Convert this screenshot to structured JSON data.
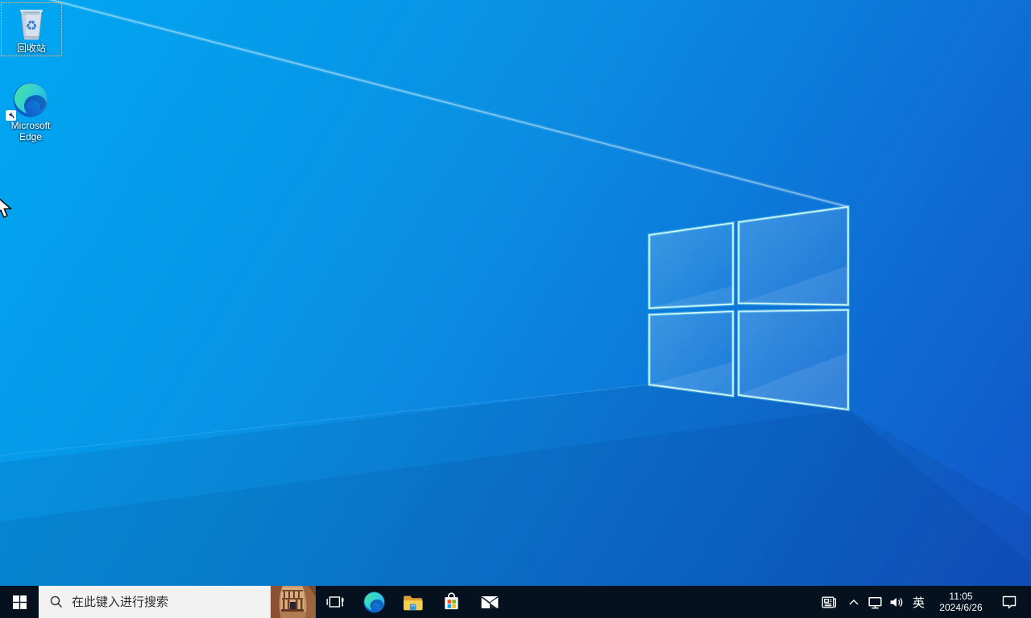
{
  "desktop": {
    "icons": [
      {
        "name": "recycle-bin",
        "label": "回收站",
        "selected": true
      },
      {
        "name": "microsoft-edge-shortcut",
        "label": "Microsoft Edge",
        "selected": false
      }
    ]
  },
  "taskbar": {
    "search": {
      "placeholder": "在此键入进行搜索",
      "icon": "search-icon",
      "highlight_image": "petra-landmark-thumbnail"
    },
    "app_icons": [
      "windows-start-icon",
      "task-view-icon",
      "edge-icon",
      "file-explorer-icon",
      "microsoft-store-icon",
      "mail-icon"
    ],
    "tray": {
      "icons": [
        "news-icon",
        "hidden-icons-chevron-icon",
        "wired-network-icon",
        "volume-icon",
        "action-center-icon"
      ],
      "ime_indicator": "英",
      "clock": {
        "time": "11:05",
        "date": "2024/6/26"
      }
    }
  },
  "colors": {
    "taskbar_bg": "#05111e",
    "search_box_bg": "#f2f2f2",
    "search_text": "#1f1f1f",
    "wallpaper_light": "#00a7f2",
    "wallpaper_dark": "#1254c8",
    "logo_stroke": "#d6fdfb",
    "store_red": "#f25022",
    "store_green": "#7fba00",
    "store_blue": "#00a4ef",
    "store_yellow": "#ffb900"
  }
}
